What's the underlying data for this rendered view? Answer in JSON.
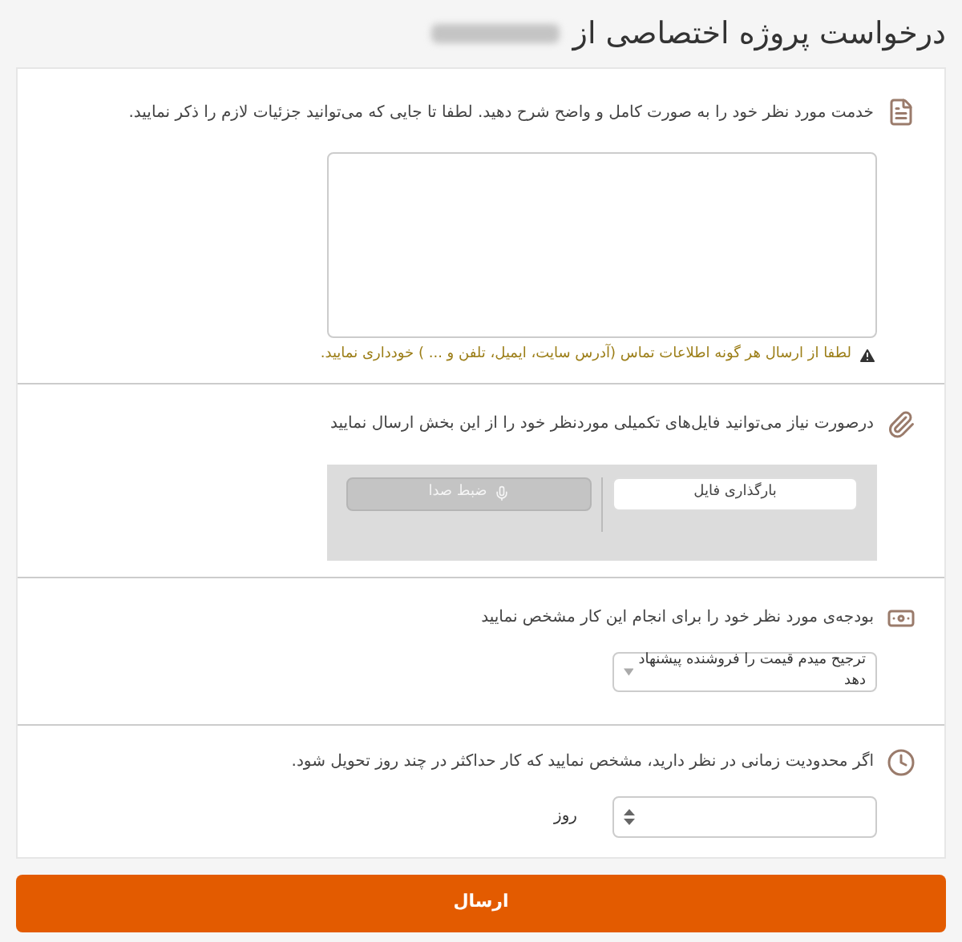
{
  "title": "درخواست پروژه اختصاصی از",
  "description": {
    "label": "خدمت مورد نظر خود را به صورت کامل و واضح شرح دهید. لطفا تا جایی که می‌توانید جزئیات لازم را ذکر نمایید.",
    "warning": "لطفا از ارسال هر گونه اطلاعات تماس (آدرس سایت، ایمیل، تلفن و ... ) خودداری نمایید."
  },
  "attachments": {
    "label": "درصورت نیاز می‌توانید فایل‌های تکمیلی موردنظر خود را از این بخش ارسال نمایید",
    "buttons": [
      {
        "kind": "upload",
        "label": "بارگذاری فایل",
        "disabled": false
      },
      {
        "kind": "record",
        "label": "ضبط صدا",
        "disabled": true
      }
    ]
  },
  "budget": {
    "label": "بودجه‌ی مورد نظر خود را برای انجام این کار مشخص نمایید",
    "value": "ترجیح میدم قیمت را فروشنده پیشنهاد دهد"
  },
  "deadline": {
    "label": "اگر محدودیت زمانی در نظر دارید، مشخص نمایید که کار حداکثر در چند روز تحویل شود.",
    "unit": "روز"
  },
  "submit": "ارسال"
}
